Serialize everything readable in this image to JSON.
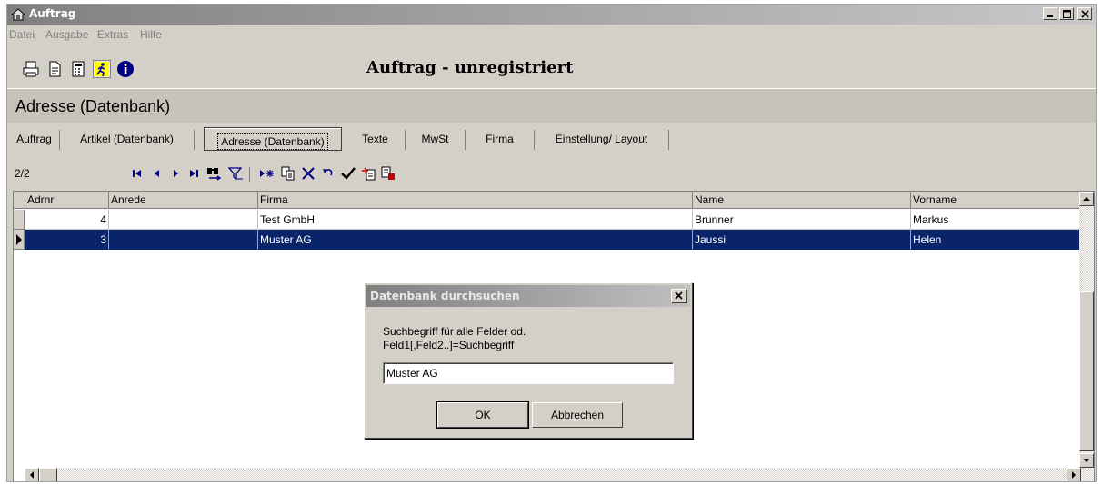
{
  "window": {
    "title": "Auftrag"
  },
  "menu": {
    "items": [
      "Datei",
      "Ausgabe",
      "Extras",
      "Hilfe"
    ]
  },
  "toolbar": {
    "heading": "Auftrag - unregistriert",
    "icons": [
      "printer-icon",
      "document-icon",
      "calculator-icon",
      "running-man-icon",
      "info-icon"
    ]
  },
  "section": {
    "title": "Adresse (Datenbank)"
  },
  "tabs": [
    {
      "label": "Auftrag",
      "active": false
    },
    {
      "label": "Artikel (Datenbank)",
      "active": false
    },
    {
      "label": "Adresse (Datenbank)",
      "active": true
    },
    {
      "label": "Texte",
      "active": false
    },
    {
      "label": "MwSt",
      "active": false
    },
    {
      "label": "Firma",
      "active": false
    },
    {
      "label": "Einstellung/ Layout",
      "active": false
    }
  ],
  "navigator": {
    "record_position": "2/2",
    "buttons": [
      "first-record-icon",
      "previous-record-icon",
      "next-record-icon",
      "last-record-icon",
      "find-icon",
      "filter-icon",
      "new-record-icon",
      "copy-icon",
      "delete-icon",
      "undo-icon",
      "save-icon",
      "import-icon",
      "export-icon"
    ]
  },
  "grid": {
    "columns": [
      "Adrnr",
      "Anrede",
      "Firma",
      "Name",
      "Vorname"
    ],
    "rows": [
      {
        "adrnr": "4",
        "anrede": "",
        "firma": "Test GmbH",
        "name": "Brunner",
        "vorname": "Markus",
        "selected": false
      },
      {
        "adrnr": "3",
        "anrede": "",
        "firma": "Muster AG",
        "name": "Jaussi",
        "vorname": "Helen",
        "selected": true
      }
    ]
  },
  "dialog": {
    "title": "Datenbank durchsuchen",
    "prompt_line1": "Suchbegriff für alle Felder od.",
    "prompt_line2": "Feld1[,Feld2..]=Suchbegriff",
    "input_value": "Muster AG",
    "ok_label": "OK",
    "cancel_label": "Abbrechen"
  },
  "colors": {
    "selection": "#0a246a",
    "window_bg": "#d4d0c8",
    "titlebar_inactive": "#808080"
  }
}
